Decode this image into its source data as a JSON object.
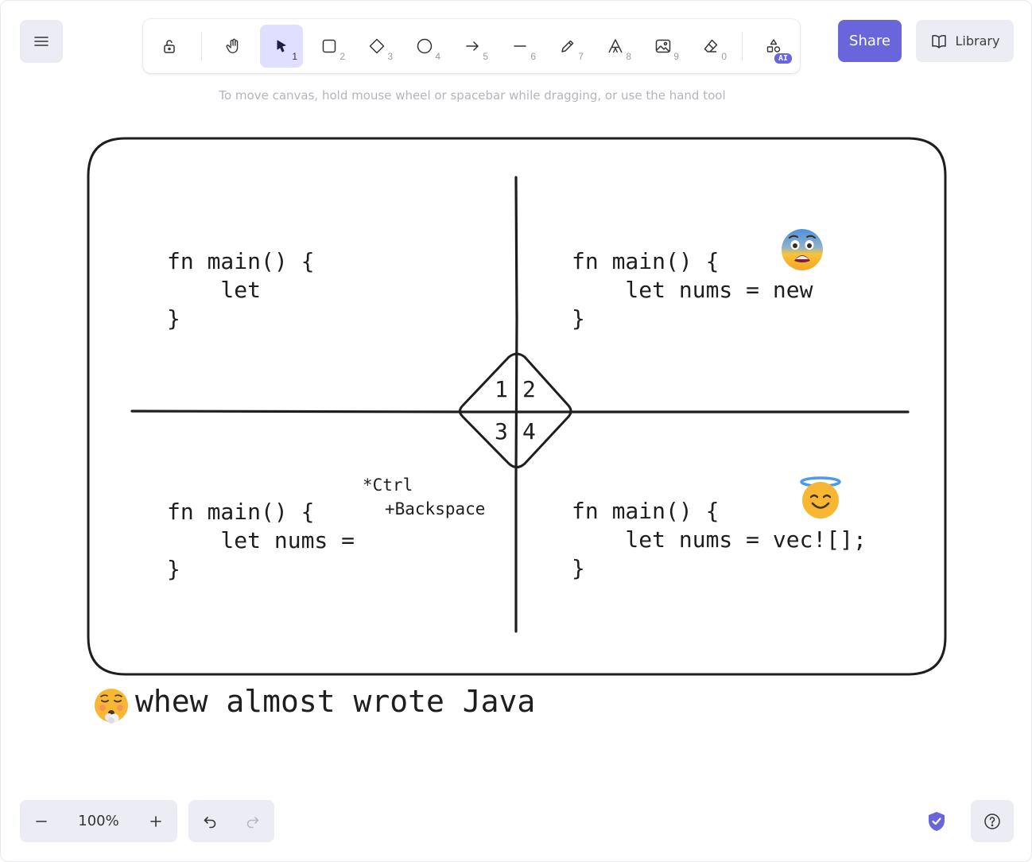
{
  "toolbar": {
    "tools": [
      {
        "name": "lock",
        "shortcut": ""
      },
      {
        "name": "hand",
        "shortcut": ""
      },
      {
        "name": "selection",
        "shortcut": "1",
        "active": true
      },
      {
        "name": "rectangle",
        "shortcut": "2"
      },
      {
        "name": "diamond",
        "shortcut": "3"
      },
      {
        "name": "ellipse",
        "shortcut": "4"
      },
      {
        "name": "arrow",
        "shortcut": "5"
      },
      {
        "name": "line",
        "shortcut": "6"
      },
      {
        "name": "draw",
        "shortcut": "7"
      },
      {
        "name": "text",
        "shortcut": "8"
      },
      {
        "name": "image",
        "shortcut": "9"
      },
      {
        "name": "eraser",
        "shortcut": "0"
      },
      {
        "name": "more-shapes",
        "badge": "AI"
      }
    ]
  },
  "header": {
    "share_label": "Share",
    "library_label": "Library",
    "hint": "To move canvas, hold mouse wheel or spacebar while dragging, or use the hand tool"
  },
  "canvas": {
    "quadrants": {
      "q1": "fn main() {\n    let\n}",
      "q2": "fn main() {\n    let nums = new\n}",
      "q3": "fn main() {\n    let nums =\n}",
      "q4": "fn main() {\n    let nums = vec![];\n}"
    },
    "diamond_labels": [
      "1",
      "2",
      "3",
      "4"
    ],
    "note_line1": "*Ctrl",
    "note_line2": "+Backspace",
    "caption": "whew almost wrote Java",
    "emojis": {
      "q2": "fearful-face",
      "q4": "smiling-face-with-halo",
      "caption": "face-exhaling"
    }
  },
  "footer": {
    "zoom_level": "100%"
  },
  "colors": {
    "accent": "#6965db",
    "accent_light": "#e0dfff",
    "island": "#ececf4",
    "stroke": "#1e1e1e"
  }
}
